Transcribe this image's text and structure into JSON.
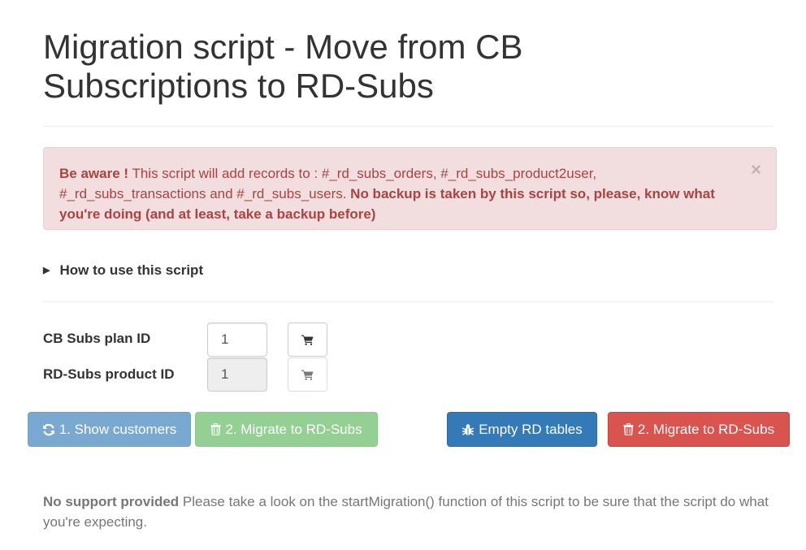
{
  "page": {
    "title": "Migration script - Move from CB Subscriptions to RD-Subs"
  },
  "alert": {
    "strong_prefix": "Be aware !",
    "text": " This script will add records to : #_rd_subs_orders, #_rd_subs_product2user, #_rd_subs_transactions and #_rd_subs_users. ",
    "strong_suffix": "No backup is taken by this script so, please, know what you're doing (and at least, take a backup before)",
    "close_symbol": "×"
  },
  "howto": {
    "marker": "▶",
    "label": "How to use this script"
  },
  "form": {
    "cb_plan_label": "CB Subs plan ID",
    "cb_plan_value": "1",
    "rd_product_label": "RD-Subs product ID",
    "rd_product_value": "1"
  },
  "buttons": {
    "show_customers": "1. Show customers",
    "migrate_green": "2. Migrate to RD-Subs",
    "empty_tables": "Empty RD tables",
    "migrate_red": "2. Migrate to RD-Subs"
  },
  "footer": {
    "strong": "No support provided",
    "text": " Please take a look on the startMigration() function of this script to be sure that the script do what you're expecting."
  },
  "colors": {
    "primary": "#337ab7",
    "success": "#5cb85c",
    "danger": "#d9534f",
    "alert_bg": "#f2dede",
    "alert_text": "#a94442"
  },
  "icons": {
    "cart": "shopping-cart-icon",
    "refresh": "refresh-icon",
    "trash": "trash-icon",
    "bug": "bug-icon",
    "close": "close-icon",
    "disclosure": "triangle-right-icon"
  }
}
